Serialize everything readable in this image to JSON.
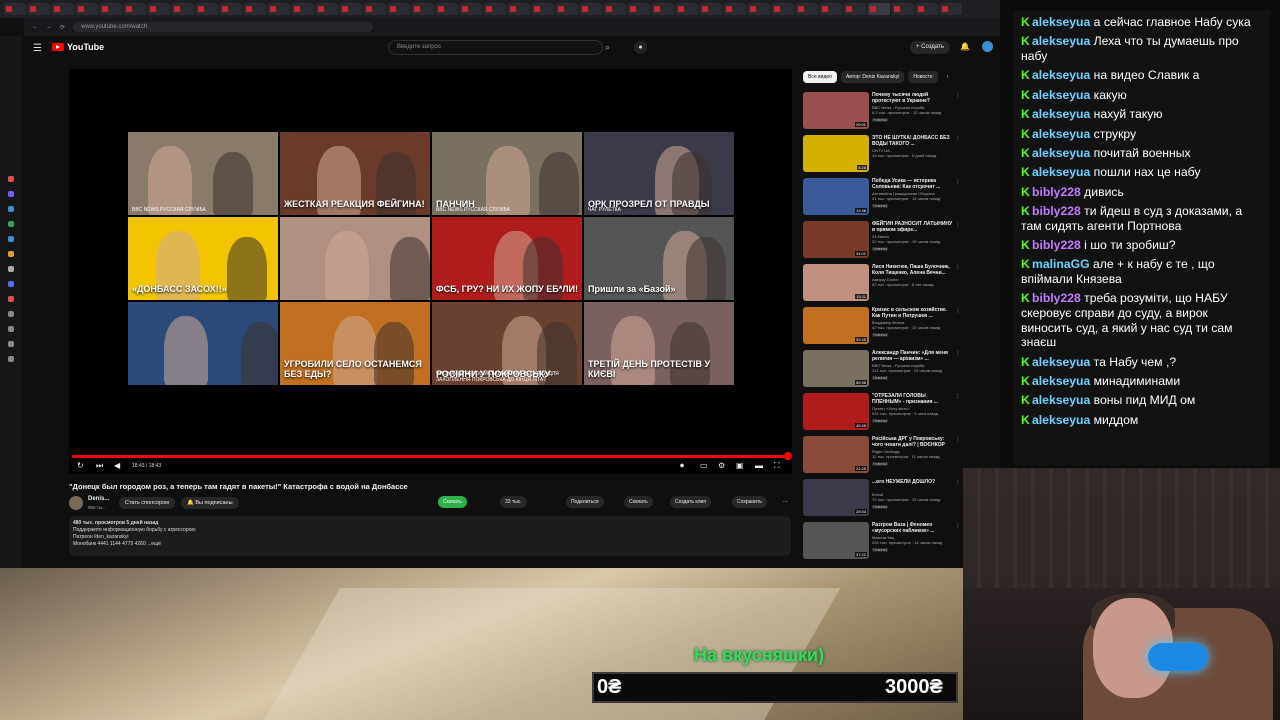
{
  "browser": {
    "url": "www.youtube.com/watch"
  },
  "youtube": {
    "logo_text": "YouTube",
    "search_placeholder": "Введите запрос",
    "create_label": "+ Создать"
  },
  "player": {
    "time": "18:43 / 18:43",
    "grid": [
      {
        "caption": "",
        "tag": "BBC NEWS РУССКАЯ СЛУЖБА",
        "bg": "#8a7a6a"
      },
      {
        "caption": "ЖЕСТКАЯ РЕАКЦИЯ ФЕЙГИНА!",
        "tag": "",
        "bg": "#6a3a2a"
      },
      {
        "caption": "ПАНЧИН",
        "tag": "BBC NEWS РУССКАЯ СЛУЖБА",
        "bg": "#7a7060"
      },
      {
        "caption": "ОРК ПРОЗРЕЛ ОТ ПРАВДЫ",
        "tag": "ЧАТ РУЛЕТКА",
        "bg": "#3a3a4a"
      },
      {
        "caption": "«ДОНБАСС ЗАСОХ!!»",
        "tag": "",
        "bg": "#f2c500"
      },
      {
        "caption": "",
        "tag": "",
        "bg": "#b09080"
      },
      {
        "caption": "ФСБ, ГРУ? НИ ИХ ЖОПУ ЕБ*ЛИ!",
        "tag": "",
        "bg": "#b01c1c"
      },
      {
        "caption": "Пришли за «Базой»",
        "tag": "",
        "bg": "#555"
      },
      {
        "caption": "",
        "tag": "",
        "bg": "#2a4a7a"
      },
      {
        "caption": "УГРОБИЛИ СЕЛО ОСТАНЕМСЯ БЕЗ ЕДЫ?",
        "tag": "",
        "bg": "#c07020"
      },
      {
        "caption": "РОСІЯНИ У ПОКРОВСЬКУ",
        "tag": "ЧИ ЗНАЙДУТЬ РОСІЙСЬКІ ВІЙСЬКА РЕСУРСИ ДЛЯ ЗАХОПЛЕННЯ ПОКРОВСЬКА ДО КІНЦЯ ЛІТА?",
        "bg": "#6a4030"
      },
      {
        "caption": "ТРЕТІЙ ДЕНЬ ПРОТЕСТІВ У КИЄВІ",
        "tag": "",
        "bg": "#7a6060"
      }
    ]
  },
  "video": {
    "title": "\"Донецк был городом роз, а теперь там гадят в пакеты!\" Катастрофа с водой на Донбассе",
    "channel": "Denis...",
    "subs": "965 ты...",
    "sponsor_label": "Стать спонсором",
    "subscribed_label": "Вы подписаны",
    "actions": [
      "Скачать",
      "33 тыс.",
      "Поделиться",
      "Скачать",
      "Создать клип",
      "Сохранить"
    ],
    "desc_lines": [
      "480 тыс. просмотров  5 дней назад",
      "Поддержите информационную борьбу с агрессором:",
      "Патреон    /den_kazanskyi",
      "Монобанк 4441 1144 4779 4260  ...ещё"
    ]
  },
  "recommendations": {
    "chips": [
      "Все видео",
      "Автор: Denis Kazanskyi",
      "Новосте"
    ],
    "items": [
      {
        "title": "Почему тысячи людей протестуют в Украине?",
        "channel": "BBC News - Русская служба",
        "meta": "6,2 тыс. просмотров · 12 часов назад",
        "badge": "Новинка",
        "duration": "29:01",
        "color": "#9a5050"
      },
      {
        "title": "ЭТО НЕ ШУТКА! ДОНБАСС БЕЗ ВОДЫ ТАКОГО ...",
        "channel": "ONTV UA",
        "meta": "15 тыс. просмотров · 6 дней назад",
        "badge": "",
        "duration": "8:28",
        "color": "#d4b000"
      },
      {
        "title": "Победа Усика — истерика Соловьева: Как отсрочит ...",
        "channel": "Антивойна Гражданская Оборона",
        "meta": "41 тыс. просмотров · 13 часов назад",
        "badge": "Новинка",
        "duration": "12:48",
        "color": "#3a5a9a"
      },
      {
        "title": "ФЕЙГИН РАЗНОСИТ ЛАТЫНИНУ в прямом эфире...",
        "channel": "24 Канал",
        "meta": "22 тыс. просмотров · 19 часов назад",
        "badge": "Новинка",
        "duration": "34:01",
        "color": "#7a3a2a"
      },
      {
        "title": "Лися Никитюк, Паша Булочник, Коля Тищенко, Алена Вечни...",
        "channel": "Амирку Dumer",
        "meta": "62 тыс. просмотров · 6 лет назад",
        "badge": "",
        "duration": "15:11",
        "color": "#c09080"
      },
      {
        "title": "Кризис в сельском хозяйстве. Как Путин и Патрушев ...",
        "channel": "Владимир Милов",
        "meta": "42 тыс. просмотров · 10 часов назад",
        "badge": "Новинка",
        "duration": "32:45",
        "color": "#c07020"
      },
      {
        "title": "Александр Панчин: «Для меня религия — архаизм» ...",
        "channel": "BBC News - Русская служба",
        "meta": "113 тыс. просмотров · 23 часов назад",
        "badge": "Новинка",
        "duration": "50:36",
        "color": "#7a7060"
      },
      {
        "title": "\"ОТРЕЗАЛИ ГОЛОВЫ ПЛЕННЫМ» - признания ...",
        "channel": "Проект «Хочу жить»",
        "meta": "532 тыс. просмотров · 4 часа назад",
        "badge": "Новинка",
        "duration": "45:58",
        "color": "#b01c1c"
      },
      {
        "title": "Російська ДРГ у Покровську: чого чекати далі? | ВОЄНКОР",
        "channel": "Радіо Свобода",
        "meta": "11 тыс. просмотров · 11 часов назад",
        "badge": "Новинка",
        "duration": "21:25",
        "color": "#8a4a3a"
      },
      {
        "title": "...ого НЕУЖЕЛИ ДОШЛО?",
        "channel": "Китай",
        "meta": "72 тыс. просмотров · 12 часов назад",
        "badge": "Новинка",
        "duration": "28:53",
        "color": "#3a3a4a"
      },
      {
        "title": "Разгром Baza | Феномен «мусорских пабликов» ...",
        "channel": "Максим Кац",
        "meta": "204 тыс. просмотров · 14 часов назад",
        "badge": "Новинка",
        "duration": "37:22",
        "color": "#555"
      },
      {
        "title": "В Киеве продолжаются ...",
        "channel": "",
        "meta": "",
        "badge": "",
        "duration": "",
        "color": "#6a6060"
      }
    ]
  },
  "chat": {
    "badge_glyph": "K",
    "messages": [
      {
        "user": "alekseyua",
        "color": "#6ad2ff",
        "text": "а сейчас главное Набу сука"
      },
      {
        "user": "alekseyua",
        "color": "#6ad2ff",
        "text": "Леха что ты думаешь про набу"
      },
      {
        "user": "alekseyua",
        "color": "#6ad2ff",
        "text": "на видео Славик а"
      },
      {
        "user": "alekseyua",
        "color": "#6ad2ff",
        "text": "какую"
      },
      {
        "user": "alekseyua",
        "color": "#6ad2ff",
        "text": "нахуй такую"
      },
      {
        "user": "alekseyua",
        "color": "#6ad2ff",
        "text": "струкру"
      },
      {
        "user": "alekseyua",
        "color": "#6ad2ff",
        "text": "почитай военных"
      },
      {
        "user": "alekseyua",
        "color": "#6ad2ff",
        "text": "пошли нах це набу"
      },
      {
        "user": "bibly228",
        "color": "#c07cff",
        "text": "дивись"
      },
      {
        "user": "bibly228",
        "color": "#c07cff",
        "text": "ти йдеш в суд з доказами, а там сидять агенти Портнова"
      },
      {
        "user": "bibly228",
        "color": "#c07cff",
        "text": "і шо ти зробиш?"
      },
      {
        "user": "malinaGG",
        "color": "#6ad2ff",
        "text": "але + к набу є те , що впіймали Князева"
      },
      {
        "user": "bibly228",
        "color": "#c07cff",
        "text": "треба розуміти, що НАБУ скеровує справи до суду, а вирок виносить суд, а який у нас суд ти сам знаєш"
      },
      {
        "user": "alekseyua",
        "color": "#6ad2ff",
        "text": "та Набу чем ,?"
      },
      {
        "user": "alekseyua",
        "color": "#6ad2ff",
        "text": "минадиминами"
      },
      {
        "user": "alekseyua",
        "color": "#6ad2ff",
        "text": "воны пид МИД ом"
      },
      {
        "user": "alekseyua",
        "color": "#6ad2ff",
        "text": "миддом"
      }
    ]
  },
  "goal": {
    "label": "На вкусняшки)",
    "start": "0₴",
    "end": "3000₴",
    "progress": 0
  }
}
